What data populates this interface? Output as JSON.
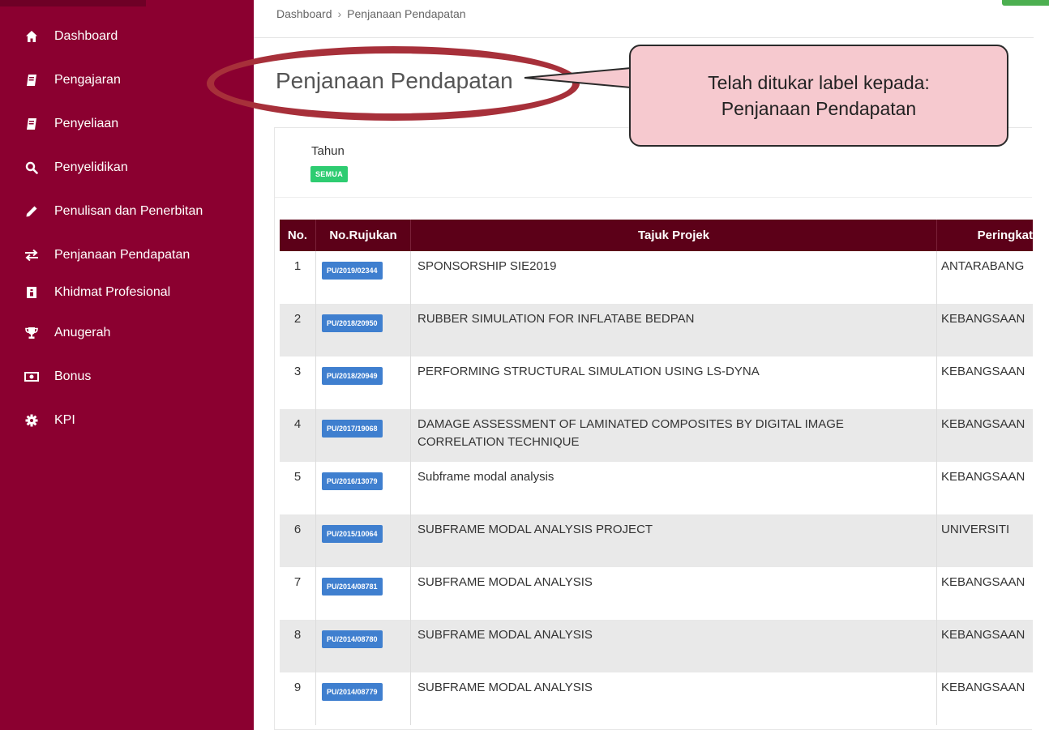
{
  "breadcrumb": {
    "home": "Dashboard",
    "separator": "›",
    "current": "Penjanaan Pendapatan"
  },
  "page": {
    "title": "Penjanaan Pendapatan"
  },
  "sidebar": {
    "items": [
      {
        "label": "Dashboard",
        "icon": "home-icon"
      },
      {
        "label": "Pengajaran",
        "icon": "book-icon"
      },
      {
        "label": "Penyeliaan",
        "icon": "book-icon"
      },
      {
        "label": "Penyelidikan",
        "icon": "search-icon"
      },
      {
        "label": "Penulisan dan Penerbitan",
        "icon": "pencil-icon"
      },
      {
        "label": "Penjanaan Pendapatan",
        "icon": "exchange-icon"
      },
      {
        "label": "Khidmat Profesional",
        "icon": "id-badge-icon"
      },
      {
        "label": "Anugerah",
        "icon": "trophy-icon"
      },
      {
        "label": "Bonus",
        "icon": "money-icon"
      },
      {
        "label": "KPI",
        "icon": "gear-icon"
      }
    ]
  },
  "filter": {
    "label": "Tahun",
    "value": "SEMUA"
  },
  "table": {
    "headers": [
      "No.",
      "No.Rujukan",
      "Tajuk Projek",
      "Peringkat"
    ],
    "rows": [
      {
        "no": "1",
        "ref": "PU/2019/02344",
        "title": "SPONSORSHIP SIE2019",
        "level": "ANTARABANG"
      },
      {
        "no": "2",
        "ref": "PU/2018/20950",
        "title": "RUBBER SIMULATION FOR INFLATABE BEDPAN",
        "level": "KEBANGSAAN"
      },
      {
        "no": "3",
        "ref": "PU/2018/20949",
        "title": "PERFORMING STRUCTURAL SIMULATION USING LS-DYNA",
        "level": "KEBANGSAAN"
      },
      {
        "no": "4",
        "ref": "PU/2017/19068",
        "title": "DAMAGE ASSESSMENT OF LAMINATED COMPOSITES BY DIGITAL IMAGE CORRELATION TECHNIQUE",
        "level": "KEBANGSAAN"
      },
      {
        "no": "5",
        "ref": "PU/2016/13079",
        "title": "Subframe modal analysis",
        "level": "KEBANGSAAN"
      },
      {
        "no": "6",
        "ref": "PU/2015/10064",
        "title": "SUBFRAME MODAL ANALYSIS PROJECT",
        "level": "UNIVERSITI"
      },
      {
        "no": "7",
        "ref": "PU/2014/08781",
        "title": "SUBFRAME MODAL ANALYSIS",
        "level": "KEBANGSAAN"
      },
      {
        "no": "8",
        "ref": "PU/2014/08780",
        "title": "SUBFRAME MODAL ANALYSIS",
        "level": "KEBANGSAAN"
      },
      {
        "no": "9",
        "ref": "PU/2014/08779",
        "title": "SUBFRAME MODAL ANALYSIS",
        "level": "KEBANGSAAN"
      }
    ]
  },
  "annotation": {
    "line1": "Telah ditukar label kepada:",
    "line2": "Penjanaan Pendapatan"
  },
  "colors": {
    "sidebar": "#8b0030",
    "table_header": "#5c0018",
    "ref_badge": "#3f7fcf",
    "filter_badge": "#2ecc71",
    "annotation_ring": "#a7303a",
    "annotation_fill": "#f6c9cf"
  }
}
